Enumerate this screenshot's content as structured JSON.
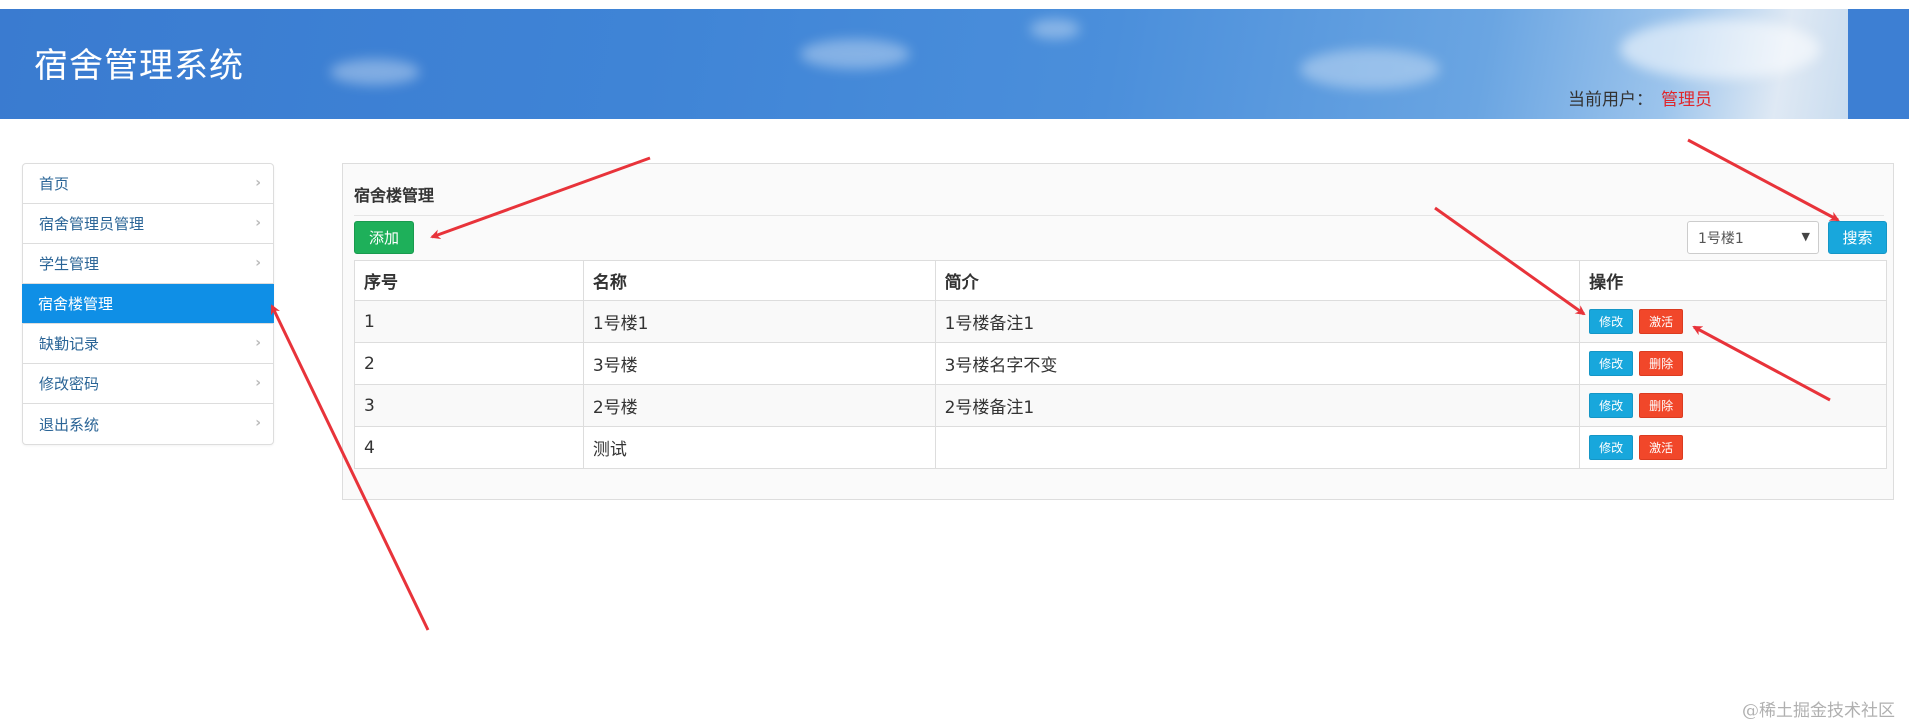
{
  "header": {
    "title": "宿舍管理系统",
    "user_label": "当前用户：",
    "user_name": "管理员"
  },
  "sidebar": {
    "items": [
      {
        "label": "首页"
      },
      {
        "label": "宿舍管理员管理"
      },
      {
        "label": "学生管理"
      },
      {
        "label": "宿舍楼管理",
        "active": true
      },
      {
        "label": "缺勤记录"
      },
      {
        "label": "修改密码"
      },
      {
        "label": "退出系统"
      }
    ]
  },
  "panel": {
    "title": "宿舍楼管理",
    "add_label": "添加",
    "search_label": "搜索",
    "select_value": "1号楼1"
  },
  "table": {
    "headers": [
      "序号",
      "名称",
      "简介",
      "操作"
    ],
    "rows": [
      {
        "id": "1",
        "name": "1号楼1",
        "desc": "1号楼备注1",
        "edit": "修改",
        "action": "激活"
      },
      {
        "id": "2",
        "name": "3号楼",
        "desc": "3号楼名字不变",
        "edit": "修改",
        "action": "删除"
      },
      {
        "id": "3",
        "name": "2号楼",
        "desc": "2号楼备注1",
        "edit": "修改",
        "action": "删除"
      },
      {
        "id": "4",
        "name": "测试",
        "desc": "",
        "edit": "修改",
        "action": "激活"
      }
    ]
  },
  "watermark": "@稀土掘金技术社区",
  "colors": {
    "header_bg": "#3f84d6",
    "active_nav": "#0f8fe6",
    "add_button": "#1eb05a",
    "info_button": "#18a7dc",
    "danger_button": "#f1472a",
    "user_name": "#e0262c",
    "annotation_arrow": "#e8333a"
  }
}
